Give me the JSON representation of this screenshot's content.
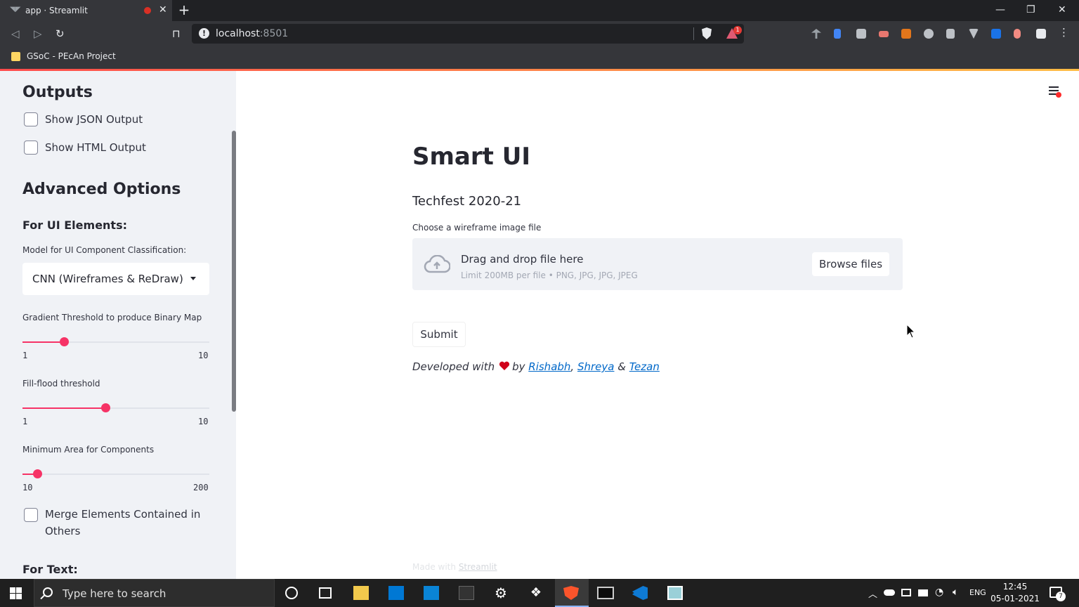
{
  "browser": {
    "tab_title": "app · Streamlit",
    "url_host": "localhost",
    "url_port": ":8501",
    "bookmark": "GSoC - PEcAn Project",
    "shield_count": "1"
  },
  "sidebar": {
    "outputs_title": "Outputs",
    "show_json": "Show JSON Output",
    "show_html": "Show HTML Output",
    "advanced_title": "Advanced Options",
    "ui_elements_title": "For UI Elements:",
    "model_label": "Model for UI Component Classification:",
    "model_value": "CNN (Wireframes & ReDraw)",
    "gradient": {
      "label": "Gradient Threshold to produce Binary Map",
      "min": "1",
      "max": "10",
      "value": 3
    },
    "fillflood": {
      "label": "Fill-flood threshold",
      "min": "1",
      "max": "10",
      "value": 5
    },
    "minarea": {
      "label": "Minimum Area for Components",
      "min": "10",
      "max": "200",
      "value": 25
    },
    "merge_label": "Merge Elements Contained in Others",
    "text_title": "For Text:"
  },
  "main": {
    "title": "Smart UI",
    "subtitle": "Techfest 2020-21",
    "upload_label": "Choose a wireframe image file",
    "drop_main": "Drag and drop file here",
    "drop_sub": "Limit 200MB per file • PNG, JPG, JPG, JPEG",
    "browse": "Browse files",
    "submit": "Submit",
    "dev_prefix": "Developed with",
    "dev_by": "by",
    "author1": "Rishabh",
    "comma": ",",
    "author2": "Shreya",
    "amp": "&",
    "author3": "Tezan",
    "made_with": "Made with",
    "made_link": "Streamlit"
  },
  "taskbar": {
    "search_placeholder": "Type here to search",
    "lang": "ENG",
    "time": "12:45",
    "date": "05-01-2021",
    "notif_count": "7"
  },
  "colors": {
    "accent": "#f63366",
    "link": "#0068c9",
    "sidebar_bg": "#f0f2f6"
  }
}
